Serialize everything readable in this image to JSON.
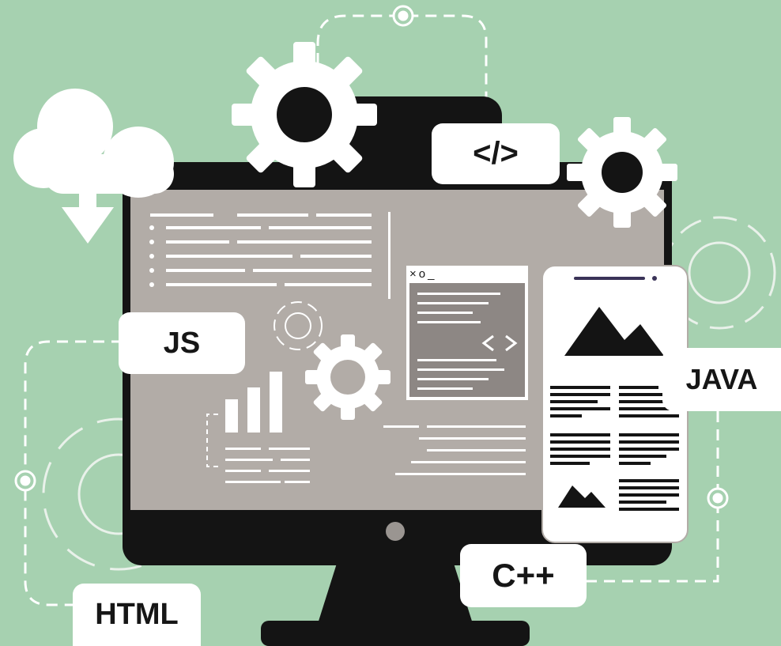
{
  "labels": {
    "code_tag": "</>",
    "js": "JS",
    "java": "JAVA",
    "cpp": "C++",
    "html": "HTML"
  },
  "window": {
    "controls": "×o_"
  },
  "colors": {
    "background": "#a6d1b0",
    "monitor": "#141414",
    "screen": "#b2aca7",
    "white": "#ffffff",
    "outline_gear": "#e9f1ea"
  },
  "icons": [
    "cloud-download-icon",
    "gear-icon",
    "code-brackets-icon",
    "bar-chart-icon",
    "mountain-image-icon",
    "dashed-connector-line"
  ]
}
